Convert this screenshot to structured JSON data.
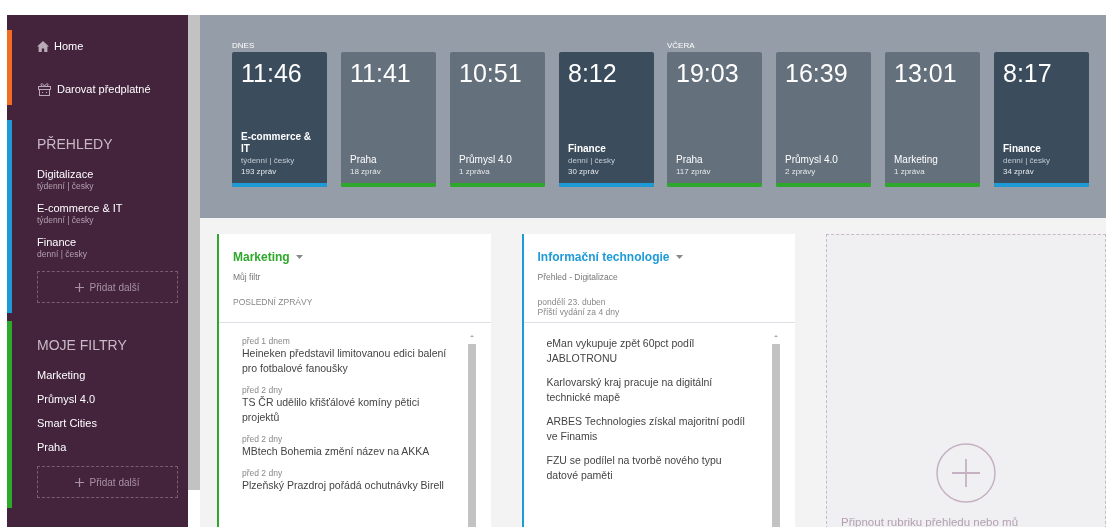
{
  "sidebar": {
    "nav": [
      {
        "kind": "home",
        "label": "Home"
      },
      {
        "kind": "gift",
        "label": "Darovat předplatné"
      }
    ],
    "sections": [
      {
        "title": "PŘEHLEDY",
        "color": "#1e9bd7",
        "items": [
          {
            "label": "Digitalizace",
            "sub": "týdenní | česky"
          },
          {
            "label": "E-commerce & IT",
            "sub": "týdenní | česky"
          },
          {
            "label": "Finance",
            "sub": "denní | česky"
          }
        ],
        "add": "Přidat další"
      },
      {
        "title": "MOJE FILTRY",
        "color": "#2ea82a",
        "items": [
          {
            "label": "Marketing"
          },
          {
            "label": "Průmysl 4.0"
          },
          {
            "label": "Smart Cities"
          },
          {
            "label": "Praha"
          }
        ],
        "add": "Přidat další"
      }
    ]
  },
  "timeline": [
    {
      "day": "DNES",
      "cards": [
        {
          "kind": "overview",
          "time": "11:46",
          "title": "E-commerce & IT",
          "sub": "týdenní | česky",
          "count": "193 zpráv"
        },
        {
          "kind": "filter",
          "time": "11:41",
          "title": "Praha",
          "count": "18 zpráv"
        },
        {
          "kind": "filter",
          "time": "10:51",
          "title": "Průmysl 4.0",
          "count": "1 zpráva"
        },
        {
          "kind": "overview",
          "time": "8:12",
          "title": "Finance",
          "sub": "denní | česky",
          "count": "30 zpráv"
        }
      ]
    },
    {
      "day": "VČERA",
      "cards": [
        {
          "kind": "filter",
          "time": "19:03",
          "title": "Praha",
          "count": "117 zpráv"
        },
        {
          "kind": "filter",
          "time": "16:39",
          "title": "Průmysl 4.0",
          "count": "2 zprávy"
        },
        {
          "kind": "filter",
          "time": "13:01",
          "title": "Marketing",
          "count": "1 zpráva"
        },
        {
          "kind": "overview",
          "time": "8:17",
          "title": "Finance",
          "sub": "denní | česky",
          "count": "34 zpráv"
        }
      ]
    }
  ],
  "panels": [
    {
      "kind": "filter",
      "title": "Marketing",
      "subtitle": "Můj filtr",
      "meta": [
        "POSLEDNÍ ZPRÁVY"
      ],
      "items": [
        {
          "age": "před 1 dnem",
          "headline": "Heineken představil limitovanou edici balení pro fotbalové fanoušky"
        },
        {
          "age": "před 2 dny",
          "headline": "TS ČR udělilo křišťálové komíny pětici projektů"
        },
        {
          "age": "před 2 dny",
          "headline": "MBtech Bohemia změní název na AKKA"
        },
        {
          "age": "před 2 dny",
          "headline": "Plzeňský Prazdroj pořádá ochutnávky Birell"
        }
      ]
    },
    {
      "kind": "overview",
      "title": "Informační technologie",
      "subtitle": "Přehled - Digitalizace",
      "meta": [
        "pondělí 23. duben",
        "Příští vydání za 4 dny"
      ],
      "items": [
        {
          "headline": "eMan vykupuje zpět 60pct podíl JABLOTRONU"
        },
        {
          "headline": "Karlovarský kraj pracuje na digitální technické mapě"
        },
        {
          "headline": "ARBES Technologies získal majoritní podíl ve Finamis"
        },
        {
          "headline": "FZU se podílel na tvorbě nového typu datové paměti"
        }
      ]
    }
  ],
  "pin": {
    "label": "Připnout rubriku přehledu nebo mů"
  }
}
